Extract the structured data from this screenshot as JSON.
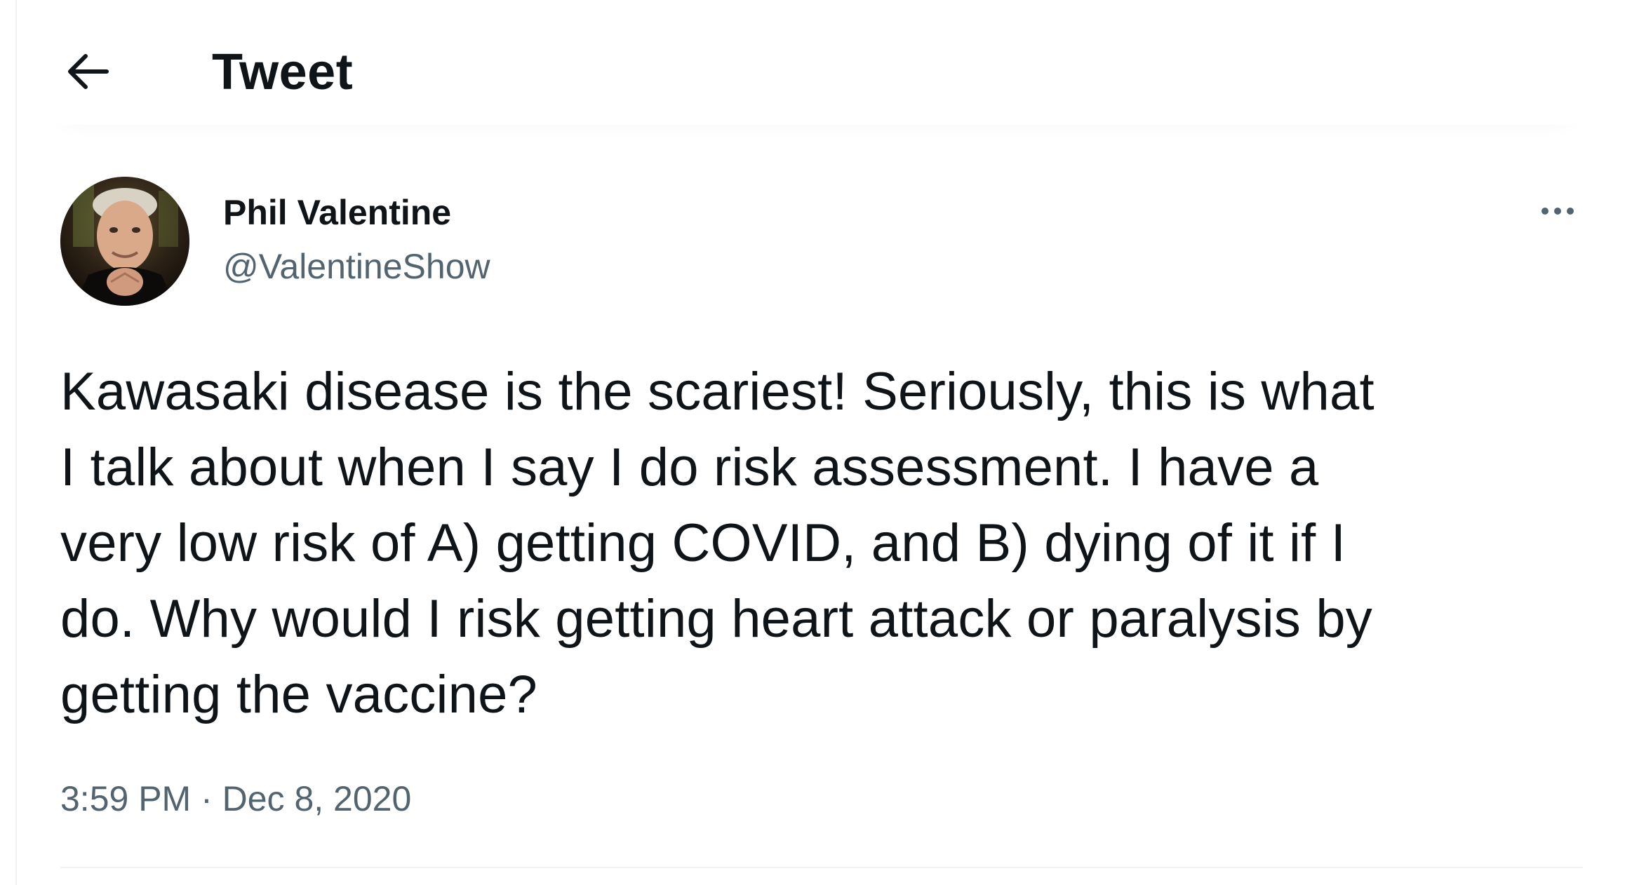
{
  "header": {
    "title": "Tweet",
    "back_icon": "arrow-left-icon"
  },
  "tweet": {
    "author": {
      "display_name": "Phil Valentine",
      "handle": "@ValentineShow",
      "avatar": "profile-photo"
    },
    "more_icon": "more-dots-icon",
    "text": "Kawasaki disease is the scariest! Seriously, this is what\nI talk about when I say I do risk assessment. I have a\nvery low risk of A) getting COVID, and B) dying of it if I\ndo. Why would I risk getting heart attack or paralysis by\ngetting the vaccine?",
    "timestamp": "3:59 PM · Dec 8, 2020"
  },
  "colors": {
    "text_primary": "#0f1419",
    "text_secondary": "#536471",
    "divider": "#eff3f4",
    "background": "#ffffff"
  }
}
